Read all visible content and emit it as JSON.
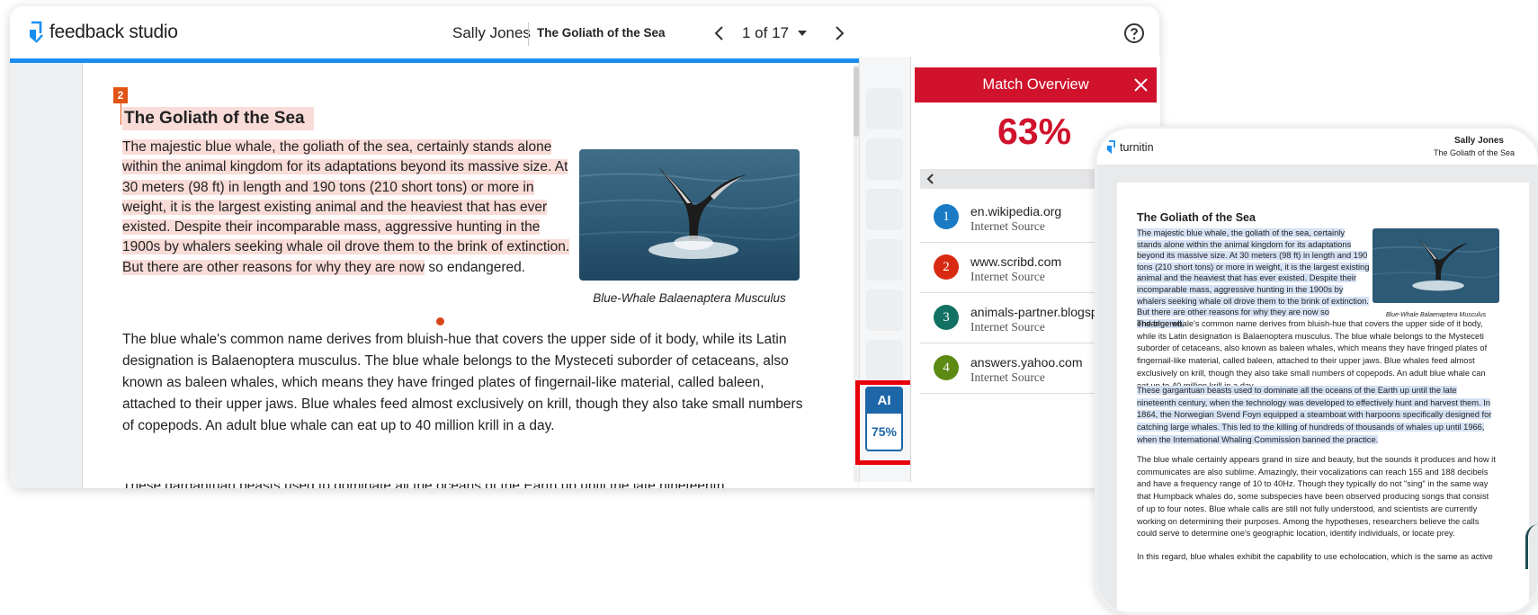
{
  "app": {
    "logo_text": "feedback studio",
    "student_name": "Sally Jones",
    "doc_title": "The Goliath of the Sea",
    "page_indicator": "1 of 17"
  },
  "colors": {
    "brand_blue": "#1a8ef0",
    "match_red": "#d0122c",
    "ai_blue": "#1d66a8",
    "match_highlight": "#f9dcd8",
    "ai_highlight": "#d5e1f4"
  },
  "document": {
    "page_number": "2",
    "title": "The Goliath of the Sea",
    "para1_highlight": "The majestic blue whale, the goliath of the sea, certainly stands alone within the animal kingdom for its adaptations beyond its massive size. At 30 meters (98 ft) in length and 190 tons (210 short tons) or more in weight, it is the largest existing animal and the heaviest that has ever existed. Despite their incomparable mass, aggressive hunting in the 1900s by whalers seeking whale oil drove them to the brink of extinction. But there are other reasons for why they are now",
    "para1_rest": " so endangered.",
    "image_caption": "Blue-Whale Balaenaptera Musculus",
    "para2": "The blue whale's common name derives from bluish-hue that covers the upper side of it body, while its Latin designation is Balaenoptera musculus. The blue whale belongs to the Mysteceti suborder of cetaceans, also known as baleen whales, which means they have fringed plates of fingernail-like material, called baleen, attached to their upper jaws. Blue whales feed almost exclusively on krill, though they also take small numbers of copepods. An adult blue whale can eat up to 40 million krill in a day.",
    "para3_start": "These gargantuan beasts used to dominate all the oceans of the Earth up until the late nineteenth"
  },
  "ai_indicator": {
    "label": "AI",
    "percent": "75%"
  },
  "match_overview": {
    "title": "Match Overview",
    "percent": "63%",
    "sources": [
      {
        "num": "1",
        "name": "en.wikipedia.org",
        "type": "Internet Source",
        "color": "#1a7bc4"
      },
      {
        "num": "2",
        "name": "www.scribd.com",
        "type": "Internet Source",
        "color": "#d82a12"
      },
      {
        "num": "3",
        "name": "animals-partner.blogsp...",
        "type": "Internet Source",
        "color": "#127163"
      },
      {
        "num": "4",
        "name": "answers.yahoo.com",
        "type": "Internet Source",
        "color": "#5c8a12"
      }
    ]
  },
  "turnitin_view": {
    "logo_text": "turnitin",
    "student_name": "Sally Jones",
    "doc_title": "The Goliath of the Sea",
    "title": "The Goliath of the Sea",
    "para1": "The majestic blue whale, the goliath of the sea, certainly stands alone within the animal kingdom for its adaptations beyond its massive size. At 30 meters (98 ft) in length and 190 tons (210 short tons) or more in weight, it is the largest existing animal and the heaviest that has ever existed. Despite their incomparable mass, aggressive hunting in the 1900s by whalers seeking whale oil drove them to the brink of extinction. But there are other reasons for why they are now so endangered.",
    "image_caption": "Blue-Whale Balaenaptera Musculus",
    "para2": "The blue whale's common name derives from bluish-hue that covers the upper side of it body, while its Latin designation is Balaenoptera musculus. The blue whale belongs to the Mysteceti suborder of cetaceans, also known as baleen whales, which means they have fringed plates of fingernail-like material, called baleen, attached to their upper jaws. Blue whales feed almost exclusively on krill, though they also take small numbers of copepods. An adult blue whale can eat up to 40 million krill in a day.",
    "para3": "These gargantuan beasts used to dominate all the oceans of the Earth up until the late nineteenth century, when the technology was developed to effectively hunt and harvest them. In 1864, the Norwegian Svend Foyn equipped a steamboat with harpoons specifically designed for catching large whales. This led to the killing of hundreds of thousands of whales up until 1966, when the International Whaling Commission banned the practice.",
    "para4": "The blue whale certainly appears grand in size and beauty, but the sounds it produces and how it communicates are also sublime. Amazingly, their vocalizations can reach 155 and 188 decibels and have a frequency range of 10 to 40Hz. Though they typically do not \"sing\" in the same way that Humpback whales do, some subspecies have been observed producing songs that consist of up to four notes. Blue whale calls are still not fully understood, and scientists are currently working on determining their purposes. Among the hypotheses, researchers believe the calls could serve to determine one's geographic location, identify individuals, or locate prey.",
    "para5": "In this regard, blue whales exhibit the capability to use echolocation, which is the same as active"
  }
}
